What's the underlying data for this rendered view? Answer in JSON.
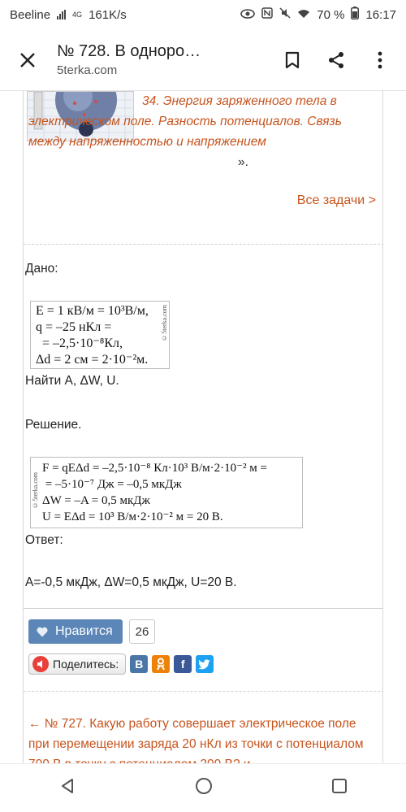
{
  "status": {
    "carrier": "Beeline",
    "network": "4G",
    "speed": "161K/s",
    "battery": "70 %",
    "time": "16:17"
  },
  "appbar": {
    "title": "№ 728. В одноро…",
    "subtitle": "5terka.com"
  },
  "article": {
    "lead_title": "34. Энергия заряженного тела в электрическом поле. Разность потенциалов. Связь между напряженностью и напряжением",
    "lead_tail": " ».",
    "all_tasks": "Все задачи >"
  },
  "solution": {
    "given_label": "Дано:",
    "given_rows": [
      "E = 1 кВ/м = 10³В/м,",
      "q = –25 нКл =",
      "  = –2,5·10⁻⁸Кл,",
      "Δd = 2 см = 2·10⁻²м."
    ],
    "watermark": "©5terka.com",
    "find_label": "Найти A, ΔW, U.",
    "solution_label": "Решение.",
    "solution_rows": [
      "F = qEΔd = –2,5·10⁻⁸ Кл·10³ В/м·2·10⁻² м =",
      " = –5·10⁻⁷ Дж = –0,5 мкДж",
      "ΔW = –A = 0,5 мкДж",
      "U = EΔd = 10³ В/м·2·10⁻² м = 20 В."
    ],
    "answer_label": "Ответ:",
    "answer_text": "A=-0,5 мкДж, ΔW=0,5 мкДж, U=20 В."
  },
  "social": {
    "like_label": "Нравится",
    "like_count": "26",
    "share_label": "Поделитесь:",
    "networks": [
      "В",
      "ok",
      "f",
      "t"
    ]
  },
  "prev_task": {
    "text": "← № 727. Какую работу совершает электрическое поле при перемещении заряда 20 нКл из точки с потенциалом 700 В в точку с потенциалом 200 В? и"
  },
  "colors": {
    "accent": "#c6541e",
    "like_blue": "#5b86b7",
    "vk": "#4a76a8",
    "ok": "#ee8208",
    "fb": "#3b5998",
    "tw": "#1da1f2"
  }
}
